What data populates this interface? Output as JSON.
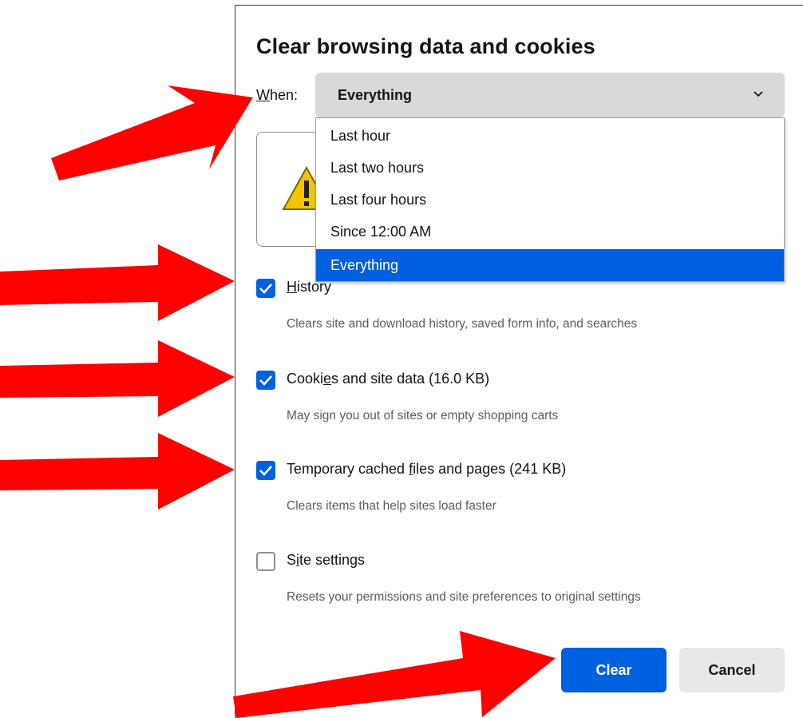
{
  "dialog": {
    "title": "Clear browsing data and cookies",
    "when_label_accel": "W",
    "when_label_rest": "hen:",
    "time_range": {
      "selected": "Everything",
      "options": [
        {
          "label": "Last hour",
          "selected": false
        },
        {
          "label": "Last two hours",
          "selected": false
        },
        {
          "label": "Last four hours",
          "selected": false
        },
        {
          "label": "Since 12:00 AM",
          "selected": false
        },
        {
          "label": "Everything",
          "selected": true
        }
      ]
    },
    "options": [
      {
        "label_before": "",
        "label_accel": "H",
        "label_after": "istory",
        "description": "Clears site and download history, saved form info, and searches",
        "checked": true
      },
      {
        "label_before": "Cooki",
        "label_accel": "e",
        "label_after": "s and site data (16.0 KB)",
        "description": "May sign you out of sites or empty shopping carts",
        "checked": true
      },
      {
        "label_before": "Temporary cached ",
        "label_accel": "f",
        "label_after": "iles and pages (241 KB)",
        "description": "Clears items that help sites load faster",
        "checked": true
      },
      {
        "label_before": "S",
        "label_accel": "i",
        "label_after": "te settings",
        "description": "Resets your permissions and site preferences to original settings",
        "checked": false
      }
    ],
    "buttons": {
      "clear": "Clear",
      "cancel": "Cancel"
    }
  },
  "colors": {
    "accent": "#0061e0",
    "annotation_arrow": "#ff0000",
    "warning": "#f5c400"
  },
  "icons": {
    "dropdown": "chevron-down-icon",
    "warning": "warning-icon",
    "check": "checkmark-icon"
  }
}
